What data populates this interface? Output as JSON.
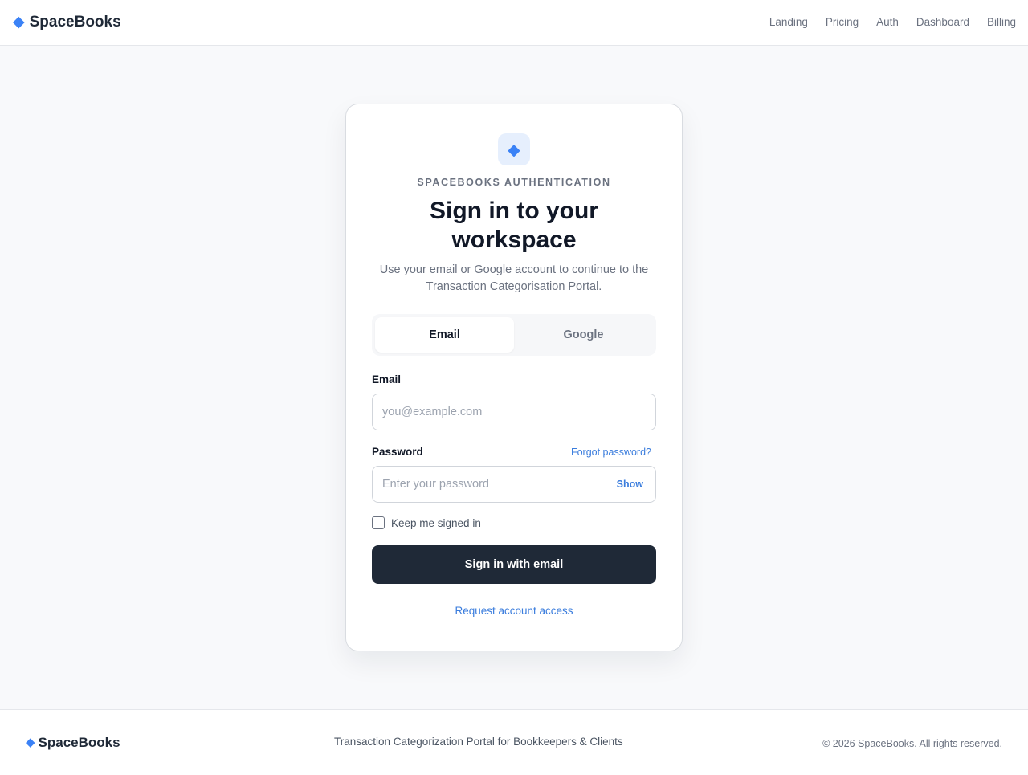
{
  "header": {
    "brand": {
      "icon": "diamond-icon",
      "glyph": "◆",
      "name": "SpaceBooks"
    },
    "nav": [
      "Landing",
      "Pricing",
      "Auth",
      "Dashboard",
      "Billing"
    ]
  },
  "auth_card": {
    "logo": {
      "icon": "diamond-icon",
      "glyph": "◆"
    },
    "eyebrow": "SPACEBOOKS AUTHENTICATION",
    "title": "Sign in to your workspace",
    "subtitle": "Use your email or Google account to continue to the Transaction Categorisation Portal.",
    "tabs": [
      {
        "label": "Email",
        "active": true
      },
      {
        "label": "Google",
        "active": false
      }
    ],
    "email": {
      "label": "Email",
      "placeholder": "you@example.com",
      "value": ""
    },
    "password": {
      "label": "Password",
      "placeholder": "Enter your password",
      "value": "",
      "forgot_label": "Forgot password?",
      "show_label": "Show"
    },
    "remember": {
      "label": "Keep me signed in",
      "checked": false
    },
    "submit_label": "Sign in with email",
    "request_access_label": "Request account access"
  },
  "footer": {
    "brand": {
      "icon": "diamond-icon",
      "glyph": "◆",
      "name": "SpaceBooks"
    },
    "tagline": "Transaction Categorization Portal for Bookkeepers & Clients",
    "copyright": "© 2026 SpaceBooks. All rights reserved."
  },
  "colors": {
    "accent": "#3b82f6",
    "link": "#3b7ddd",
    "primary_button": "#1f2937",
    "page_background": "#f8f9fb"
  }
}
